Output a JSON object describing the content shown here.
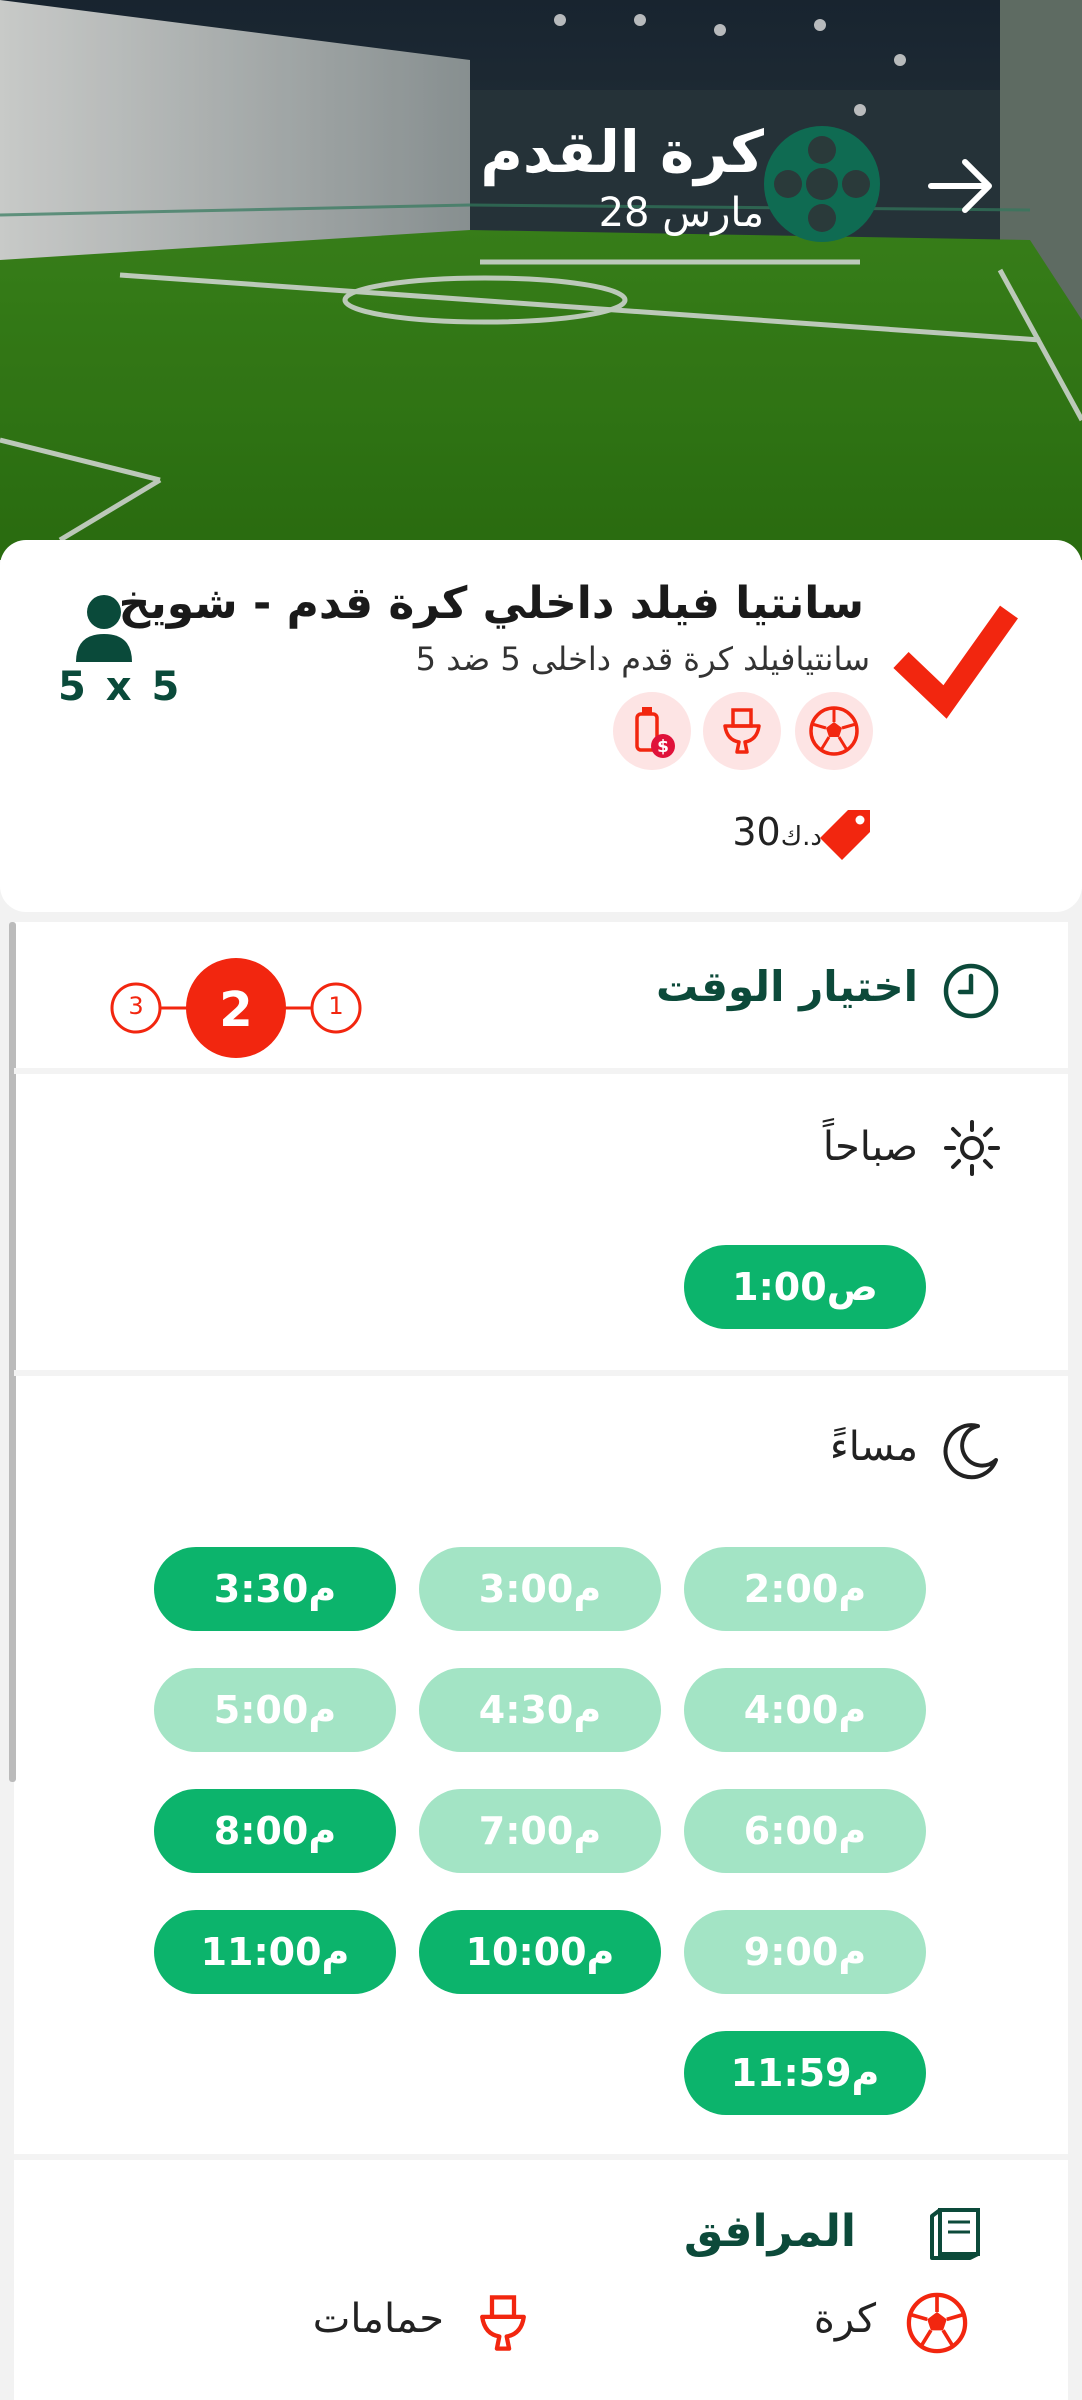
{
  "header": {
    "title": "كرة القدم",
    "date": "28 مارس",
    "back_icon": "arrow-right-icon",
    "sport_icon": "film-reel-icon"
  },
  "venue": {
    "name": "سانتيا فيلد داخلي كرة قدم - شويخ",
    "subtitle": "سانتيافيلد كرة قدم داخلى 5 ضد 5",
    "capacity": "5 x 5",
    "price_value": "30",
    "price_currency": "د.ك",
    "amenity_icons": [
      "football-icon",
      "toilet-icon",
      "paid-drink-icon"
    ]
  },
  "booking": {
    "section_title": "اختيار الوقت",
    "steps": [
      "1",
      "2",
      "3"
    ],
    "current_step": 2
  },
  "morning": {
    "label": "صباحاً",
    "slots": [
      {
        "label": "1:00ص",
        "available": true
      }
    ]
  },
  "evening": {
    "label": "مساءً",
    "slots": [
      {
        "label": "2:00م",
        "available": false
      },
      {
        "label": "3:00م",
        "available": false
      },
      {
        "label": "3:30م",
        "available": true
      },
      {
        "label": "4:00م",
        "available": false
      },
      {
        "label": "4:30م",
        "available": false
      },
      {
        "label": "5:00م",
        "available": false
      },
      {
        "label": "6:00م",
        "available": false
      },
      {
        "label": "7:00م",
        "available": false
      },
      {
        "label": "8:00م",
        "available": true
      },
      {
        "label": "9:00م",
        "available": false
      },
      {
        "label": "10:00م",
        "available": true
      },
      {
        "label": "11:00م",
        "available": true
      },
      {
        "label": "11:59م",
        "available": true
      }
    ]
  },
  "facilities": {
    "title": "المرافق",
    "items": [
      {
        "label": "كرة",
        "icon": "football-icon"
      },
      {
        "label": "حمامات",
        "icon": "toilet-icon"
      }
    ]
  },
  "colors": {
    "primary_green": "#0cb46c",
    "disabled_green": "#a3e4c5",
    "dark_green": "#0c4a3a",
    "accent_red": "#f2260f"
  }
}
